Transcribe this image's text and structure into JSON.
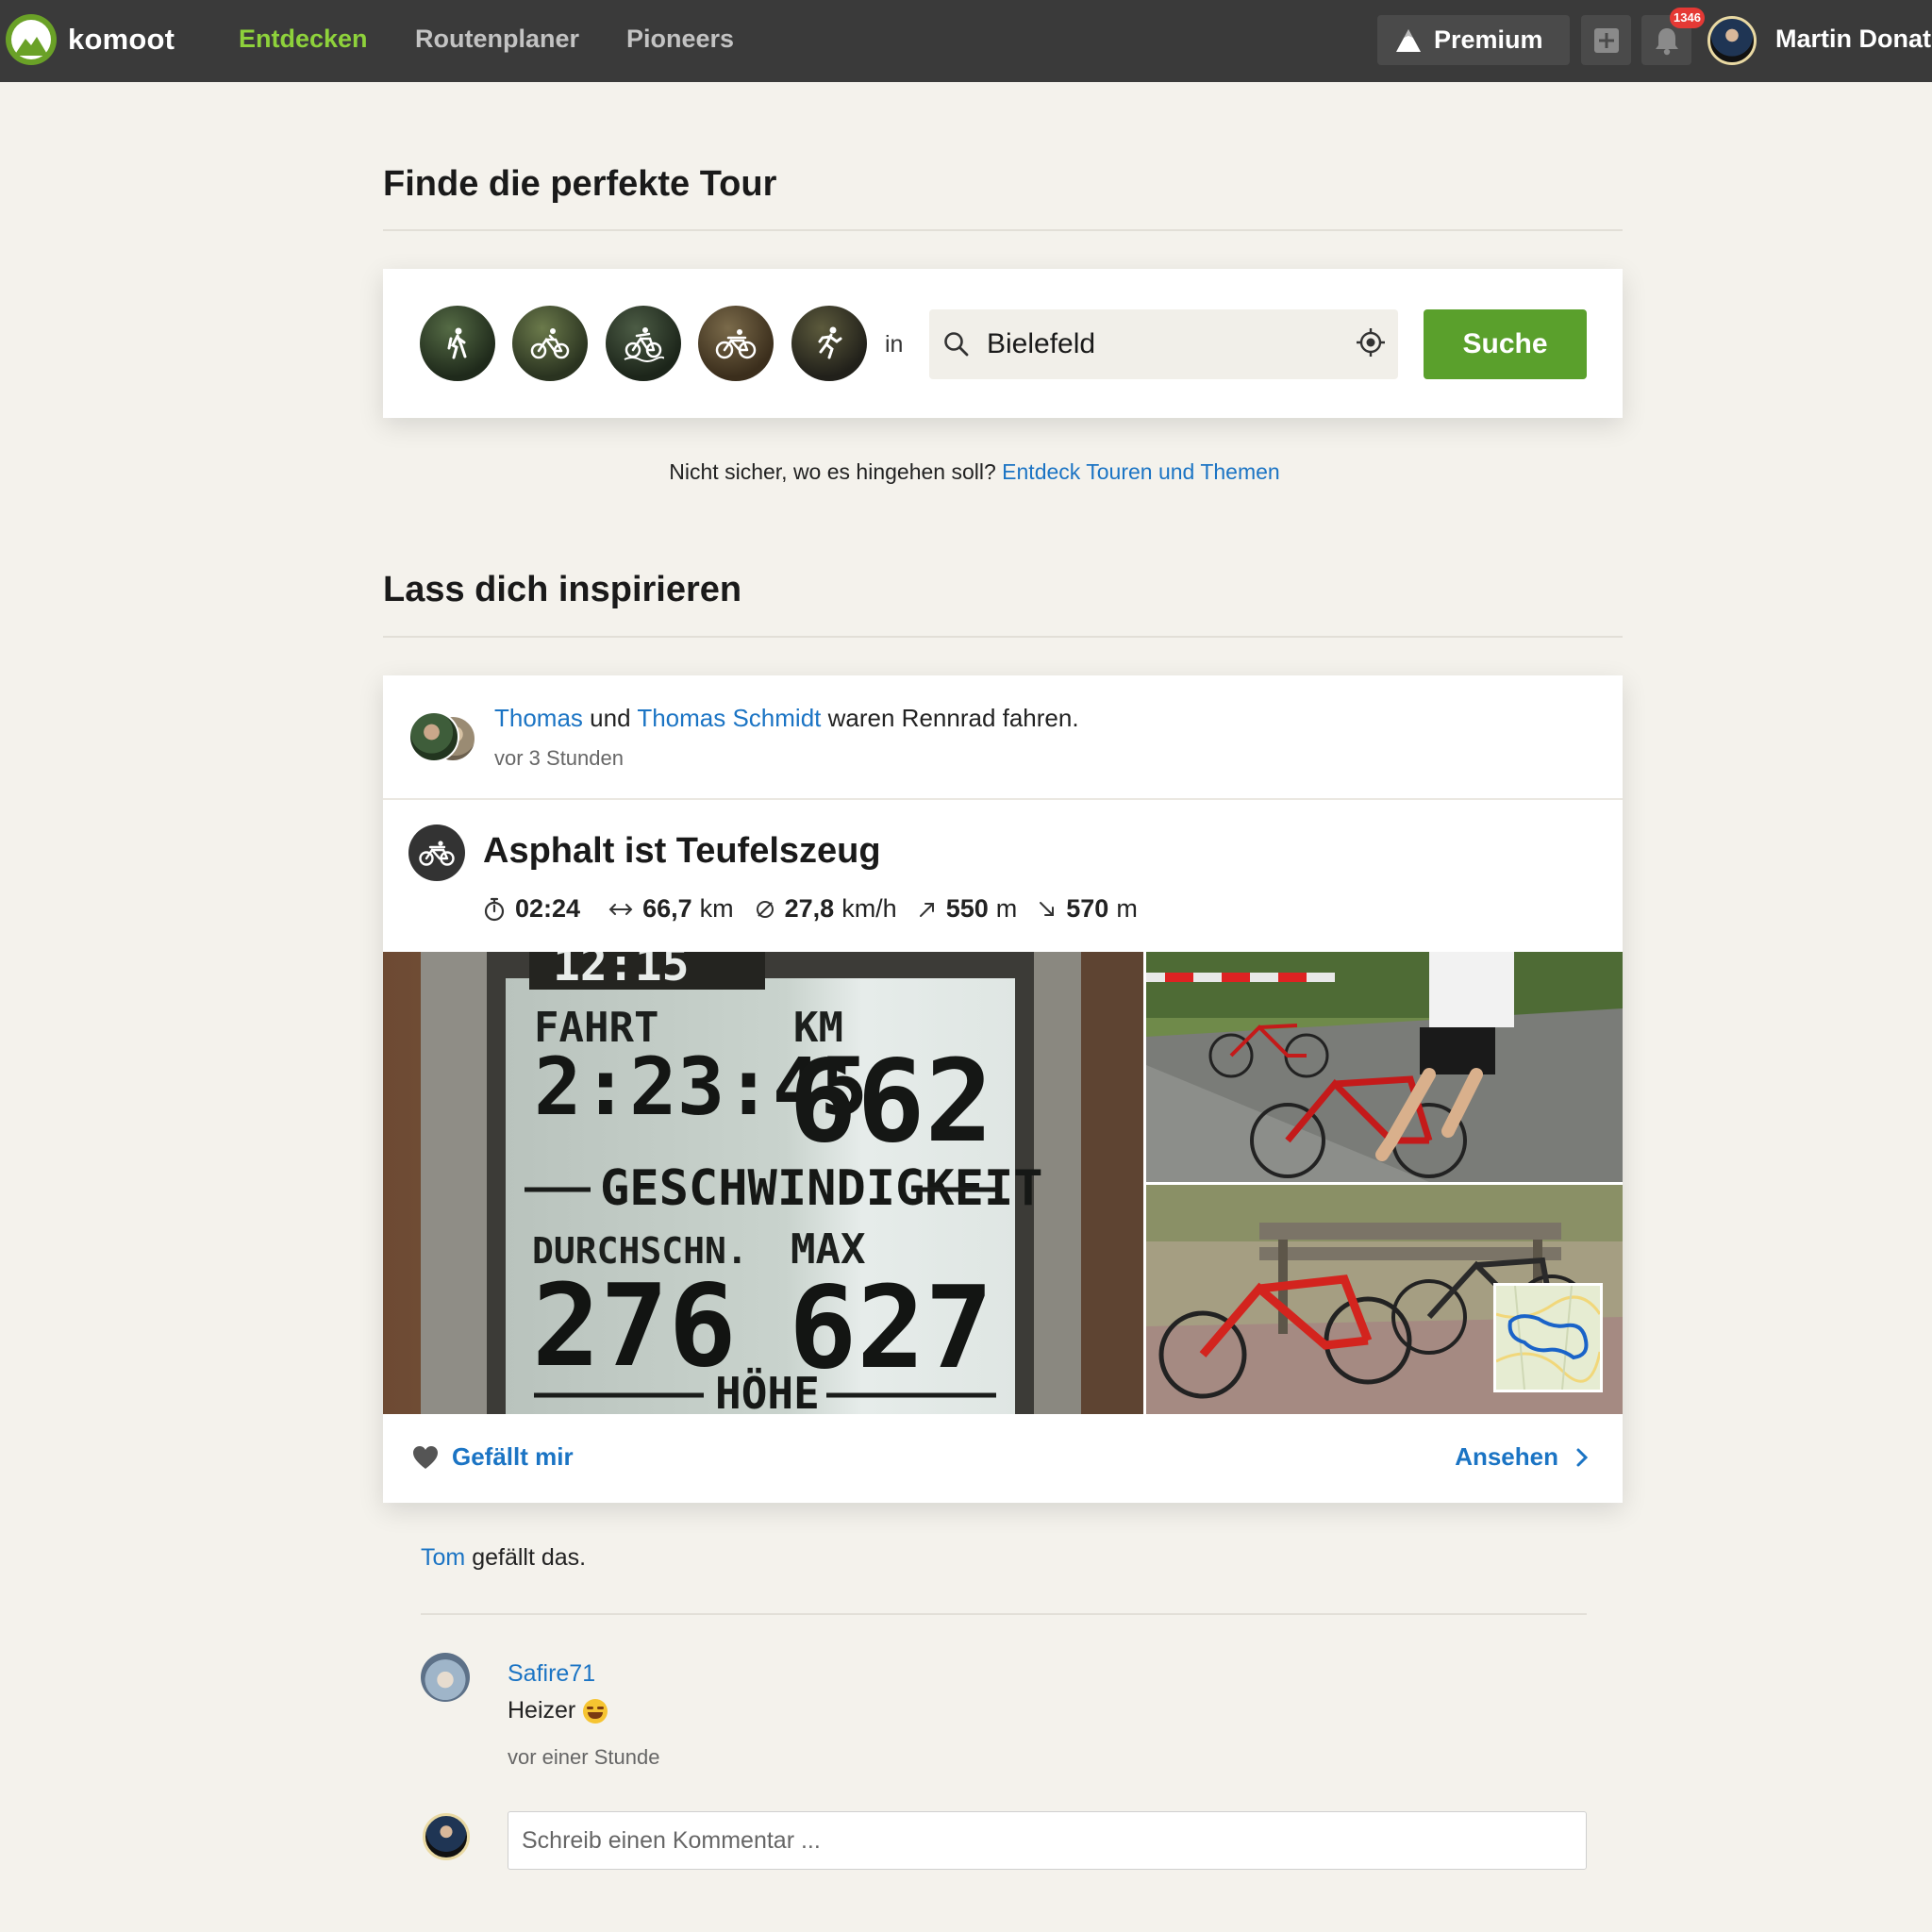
{
  "nav": {
    "logo_text": "komoot",
    "items": [
      {
        "label": "Entdecken",
        "active": true
      },
      {
        "label": "Routenplaner",
        "active": false
      },
      {
        "label": "Pioneers",
        "active": false
      }
    ],
    "premium_label": "Premium",
    "notification_count": "1346",
    "user_name": "Martin Donat"
  },
  "search": {
    "title": "Finde die perfekte Tour",
    "sports": [
      {
        "icon": "hiking-icon"
      },
      {
        "icon": "bike-touring-icon"
      },
      {
        "icon": "mountain-bike-icon"
      },
      {
        "icon": "road-bike-icon"
      },
      {
        "icon": "running-icon"
      }
    ],
    "in_label": "in",
    "location_value": "Bielefeld",
    "button_label": "Suche",
    "hint_text": "Nicht sicher, wo es hingehen soll?",
    "hint_link": "Entdeck Touren und Themen"
  },
  "inspire": {
    "title": "Lass dich inspirieren"
  },
  "feed": {
    "user1": "Thomas",
    "connector": "und",
    "user2": "Thomas Schmidt",
    "activity": "waren Rennrad fahren.",
    "time": "vor 3 Stunden",
    "tour_title": "Asphalt ist Teufelszeug",
    "stats": {
      "duration": "02:24",
      "distance": "66,7",
      "distance_unit": "km",
      "speed": "27,8",
      "speed_unit": "km/h",
      "up": "550",
      "up_unit": "m",
      "down": "570",
      "down_unit": "m"
    },
    "photo_display": {
      "time": "12:15",
      "label_ride": "FAHRT",
      "ride_time": "2:23:45",
      "label_km": "KM",
      "km": "662",
      "label_speed": "GESCHWINDIGKEIT",
      "label_avg": "DURCHSCHN.",
      "avg": "276",
      "label_max": "MAX",
      "max": "627",
      "label_alt": "HÖHE"
    },
    "like_label": "Gefällt mir",
    "view_label": "Ansehen"
  },
  "likes": {
    "user": "Tom",
    "text": "gefällt das."
  },
  "comment": {
    "user": "Safire71",
    "text": "Heizer",
    "emoji": "😂",
    "time": "vor einer Stunde"
  },
  "comment_input": {
    "placeholder": "Schreib einen Kommentar ..."
  },
  "colors": {
    "brand_green": "#5aa02c",
    "nav_active": "#8ed23b",
    "link_blue": "#1b74c4",
    "topbar": "#3a3a3a",
    "page_bg": "#f4f2ec",
    "badge_red": "#e53935"
  }
}
